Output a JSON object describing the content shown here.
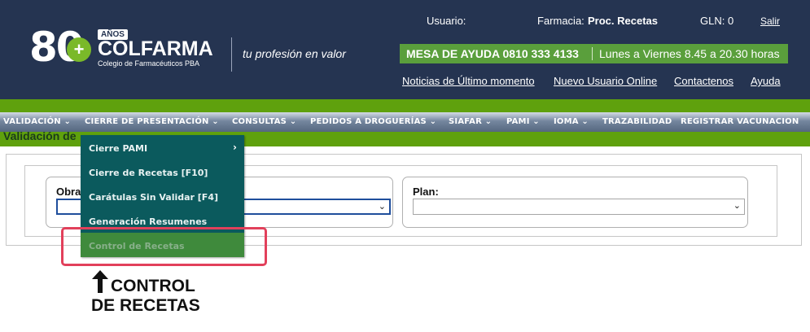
{
  "header": {
    "logo": {
      "number": "80",
      "anos": "AÑOS",
      "name": "COLFARMA",
      "subtitle": "Colegio de Farmacéuticos PBA",
      "cross": "+"
    },
    "tagline": "tu profesión en valor",
    "user_label": "Usuario:",
    "farmacia_label": "Farmacia:",
    "farmacia_value": "Proc. Recetas",
    "gln_label": "GLN:",
    "gln_value": "0",
    "logout": "Salir",
    "helpdesk": {
      "main": "MESA DE AYUDA 0810 333 4133",
      "hours": "Lunes a Viernes 8.45 a 20.30 horas"
    },
    "links": [
      "Noticias de Último momento",
      "Nuevo Usuario Online",
      "Contactenos",
      "Ayuda"
    ]
  },
  "nav": {
    "items": [
      "VALIDACIÓN ⌄",
      "CIERRE DE PRESENTACIÓN ⌄",
      "CONSULTAS ⌄",
      "PEDIDOS A DROGUERÍAS ⌄",
      "SIAFAR ⌄",
      "PAMI ⌄",
      "IOMA ⌄",
      "TRAZABILIDAD",
      "REGISTRAR VACUNACION"
    ]
  },
  "page": {
    "title": "Validación de"
  },
  "form": {
    "obra_label": "Obra",
    "plan_label": "Plan:",
    "chevron": "⌄"
  },
  "dropdown": {
    "items": [
      "Cierre PAMI",
      "Cierre de Recetas [F10]",
      "Carátulas Sin Validar [F4]",
      "Generación Resumenes",
      "Control de Recetas"
    ],
    "sub_arrow": "›"
  },
  "callout": {
    "line1": "CONTROL",
    "line2": "DE RECETAS"
  },
  "colors": {
    "header_bg": "#253451",
    "accent_green": "#5fa10d",
    "dropdown_bg": "#0b5a5d",
    "highlight": "#e2405b"
  }
}
